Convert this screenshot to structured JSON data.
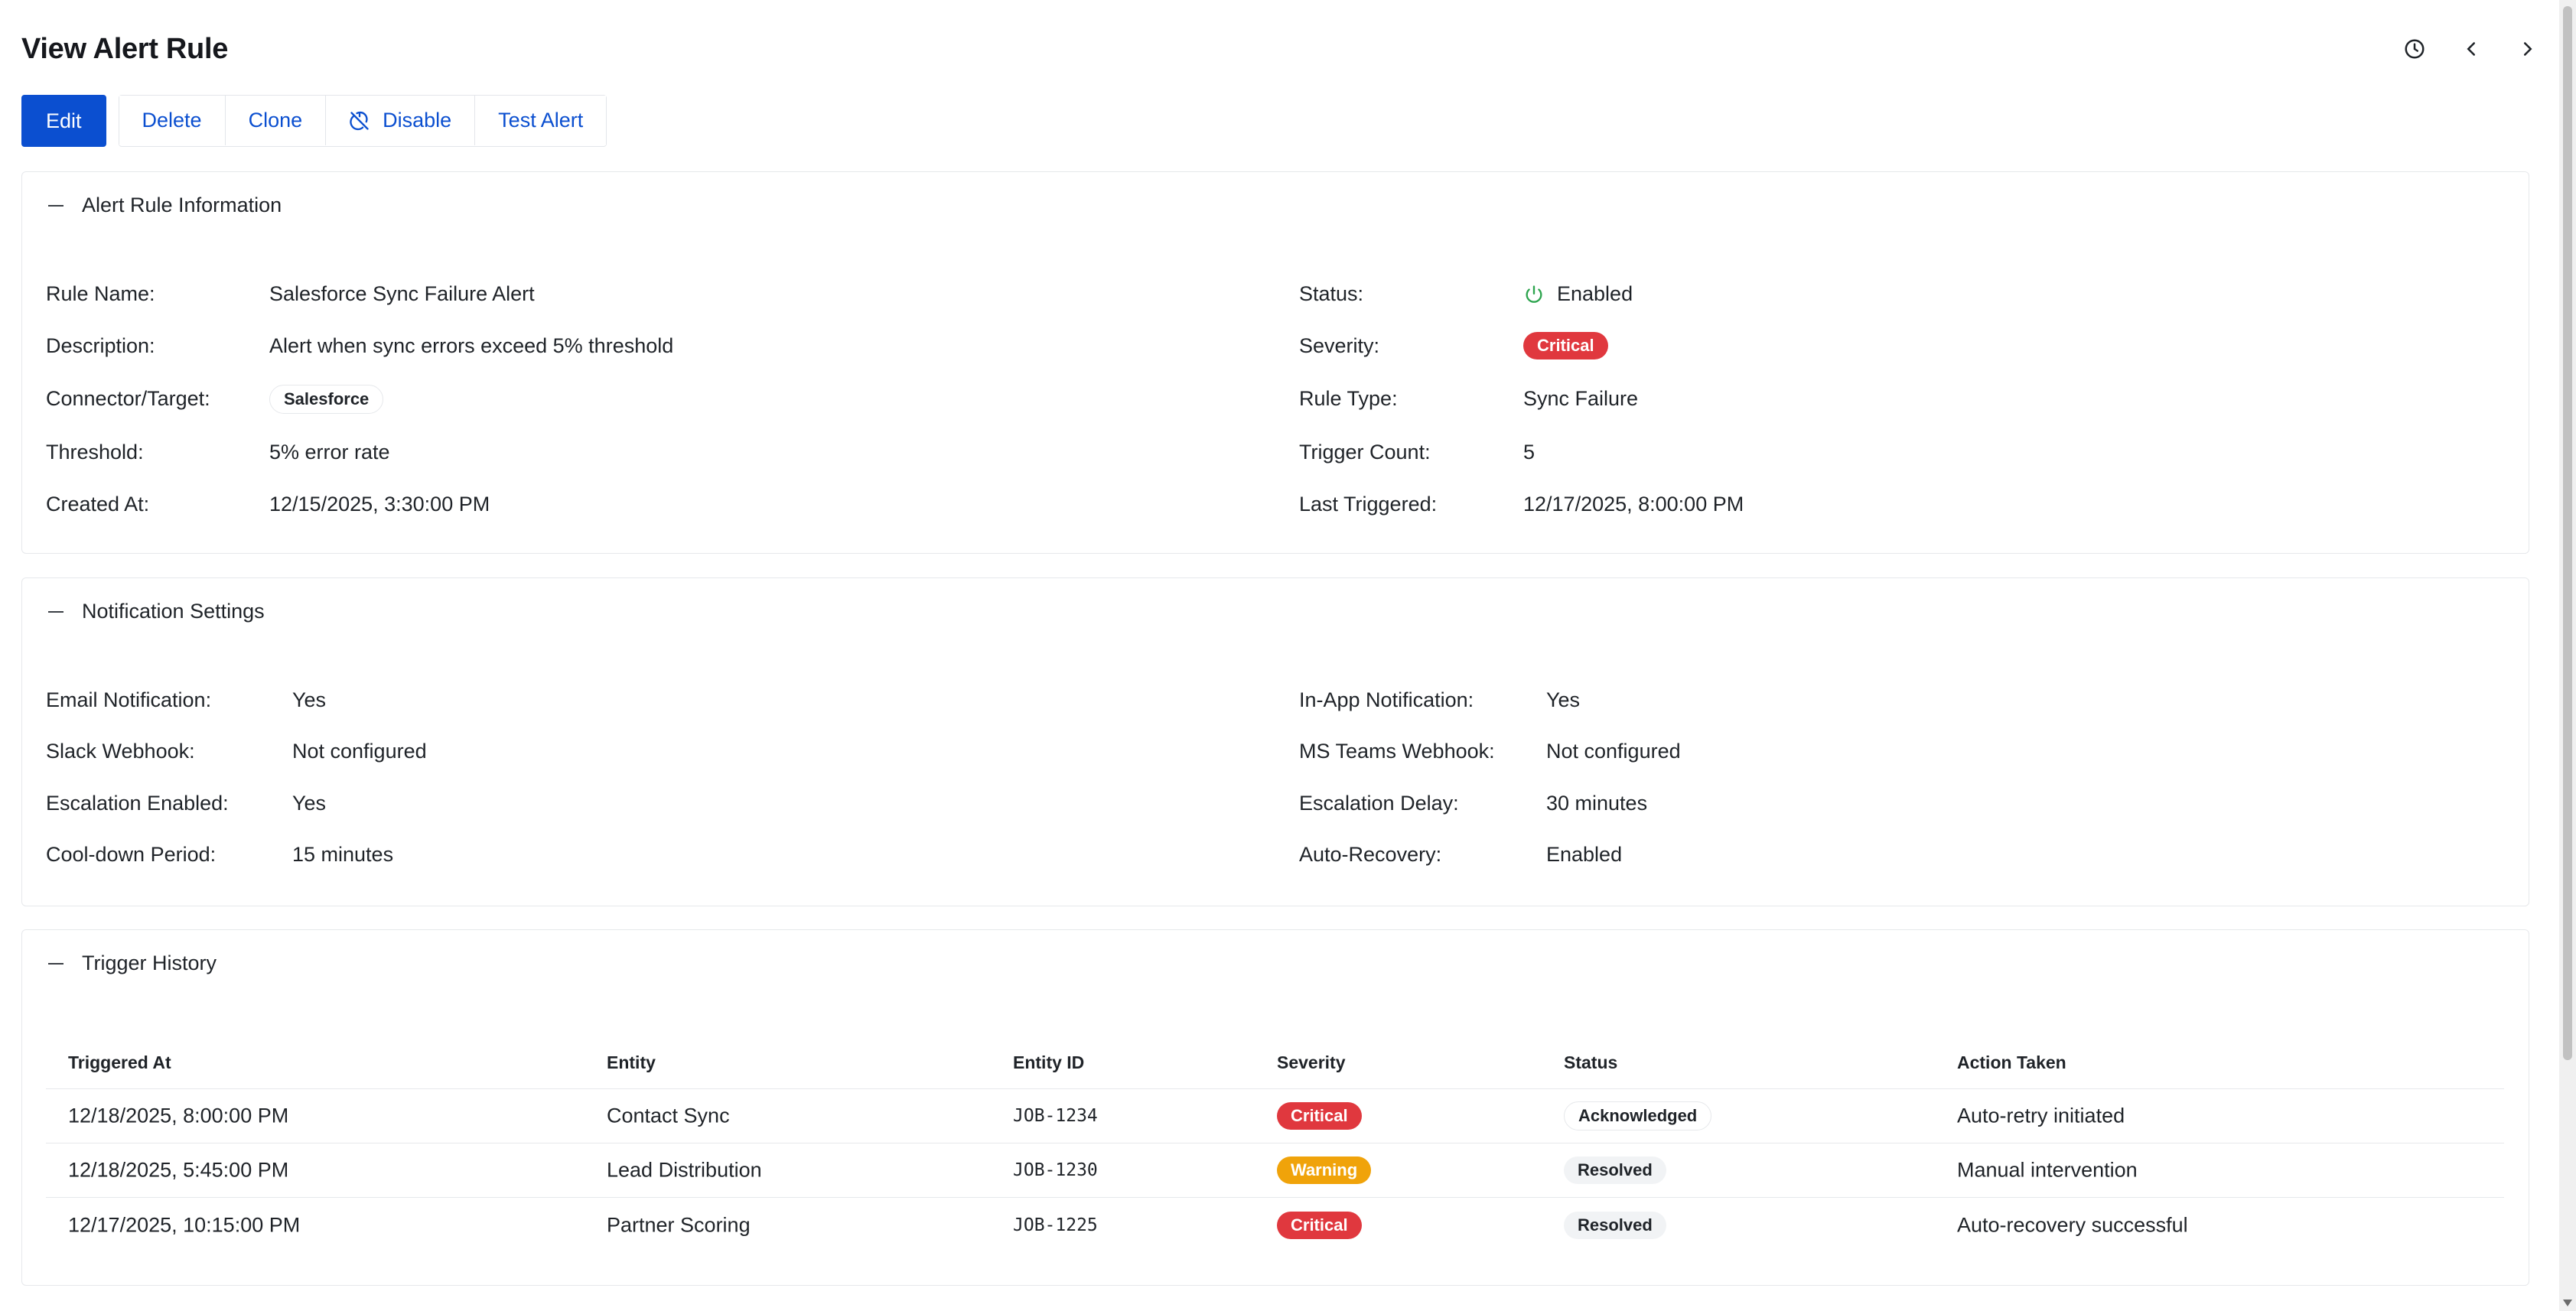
{
  "header": {
    "title": "View Alert Rule",
    "icons": [
      "history-icon",
      "chevron-left-icon",
      "chevron-right-icon"
    ]
  },
  "toolbar": {
    "edit": "Edit",
    "delete": "Delete",
    "clone": "Clone",
    "disable": "Disable",
    "test_alert": "Test Alert"
  },
  "alert_info": {
    "title": "Alert Rule Information",
    "left": [
      {
        "label": "Rule Name:",
        "value": "Salesforce Sync Failure Alert"
      },
      {
        "label": "Description:",
        "value": "Alert when sync errors exceed 5% threshold"
      },
      {
        "label": "Connector/Target:",
        "value": "Salesforce"
      },
      {
        "label": "Threshold:",
        "value": "5% error rate"
      },
      {
        "label": "Created At:",
        "value": "12/15/2025, 3:30:00 PM"
      }
    ],
    "right": [
      {
        "label": "Status:",
        "value": "Enabled"
      },
      {
        "label": "Severity:",
        "value": "Critical"
      },
      {
        "label": "Rule Type:",
        "value": "Sync Failure"
      },
      {
        "label": "Trigger Count:",
        "value": "5"
      },
      {
        "label": "Last Triggered:",
        "value": "12/17/2025, 8:00:00 PM"
      }
    ]
  },
  "notifications": {
    "title": "Notification Settings",
    "left": [
      {
        "label": "Email Notification:",
        "value": "Yes"
      },
      {
        "label": "Slack Webhook:",
        "value": "Not configured"
      },
      {
        "label": "Escalation Enabled:",
        "value": "Yes"
      },
      {
        "label": "Cool-down Period:",
        "value": "15 minutes"
      }
    ],
    "right": [
      {
        "label": "In-App Notification:",
        "value": "Yes"
      },
      {
        "label": "MS Teams Webhook:",
        "value": "Not configured"
      },
      {
        "label": "Escalation Delay:",
        "value": "30 minutes"
      },
      {
        "label": "Auto-Recovery:",
        "value": "Enabled"
      }
    ]
  },
  "history": {
    "title": "Trigger History",
    "columns": [
      "Triggered At",
      "Entity",
      "Entity ID",
      "Severity",
      "Status",
      "Action Taken"
    ],
    "rows": [
      {
        "triggered_at": "12/18/2025, 8:00:00 PM",
        "entity": "Contact Sync",
        "entity_id": "JOB-1234",
        "severity": "Critical",
        "status": "Acknowledged",
        "action": "Auto-retry initiated"
      },
      {
        "triggered_at": "12/18/2025, 5:45:00 PM",
        "entity": "Lead Distribution",
        "entity_id": "JOB-1230",
        "severity": "Warning",
        "status": "Resolved",
        "action": "Manual intervention"
      },
      {
        "triggered_at": "12/17/2025, 10:15:00 PM",
        "entity": "Partner Scoring",
        "entity_id": "JOB-1225",
        "severity": "Critical",
        "status": "Resolved",
        "action": "Auto-recovery successful"
      }
    ]
  },
  "colors": {
    "primary": "#0b4fd0",
    "critical": "#e0383e",
    "warning": "#f0a30a",
    "enabled": "#2da44e"
  }
}
